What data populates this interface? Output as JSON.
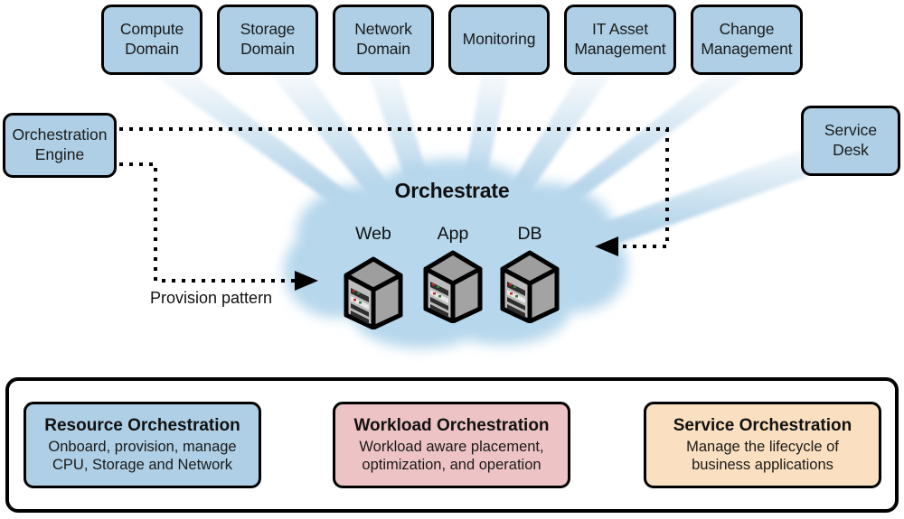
{
  "diagram": {
    "title_in_cloud": "Orchestrate",
    "provision_label": "Provision pattern",
    "colors": {
      "blue": "#aecfe5",
      "pink": "#eec3c5",
      "orange": "#fae0c0",
      "ray": "#a8cde6",
      "cloud": "#b6d7ec",
      "outline": "#000000",
      "server_body": "#a8a8a8",
      "server_dark": "#3a3a3a"
    }
  },
  "top_boxes": [
    {
      "id": "compute-domain",
      "line1": "Compute",
      "line2": "Domain"
    },
    {
      "id": "storage-domain",
      "line1": "Storage",
      "line2": "Domain"
    },
    {
      "id": "network-domain",
      "line1": "Network",
      "line2": "Domain"
    },
    {
      "id": "monitoring",
      "line1": "Monitoring",
      "line2": ""
    },
    {
      "id": "it-asset-mgmt",
      "line1": "IT Asset",
      "line2": "Management"
    },
    {
      "id": "change-mgmt",
      "line1": "Change",
      "line2": "Management"
    }
  ],
  "side_boxes": [
    {
      "id": "orchestration-engine",
      "line1": "Orchestration",
      "line2": "Engine"
    },
    {
      "id": "service-desk",
      "line1": "Service",
      "line2": "Desk"
    }
  ],
  "cloud": {
    "servers": [
      {
        "id": "web",
        "label": "Web"
      },
      {
        "id": "app",
        "label": "App"
      },
      {
        "id": "db",
        "label": "DB"
      }
    ]
  },
  "pillars": [
    {
      "id": "resource-orchestration",
      "title": "Resource Orchestration",
      "sub_line1": "Onboard, provision, manage",
      "sub_line2": "CPU, Storage and Network",
      "color": "#aecfe5"
    },
    {
      "id": "workload-orchestration",
      "title": "Workload Orchestration",
      "sub_line1": "Workload aware placement,",
      "sub_line2": "optimization, and operation",
      "color": "#eec3c5"
    },
    {
      "id": "service-orchestration",
      "title": "Service Orchestration",
      "sub_line1": "Manage the lifecycle of",
      "sub_line2": "business applications",
      "color": "#fae0c0"
    }
  ]
}
